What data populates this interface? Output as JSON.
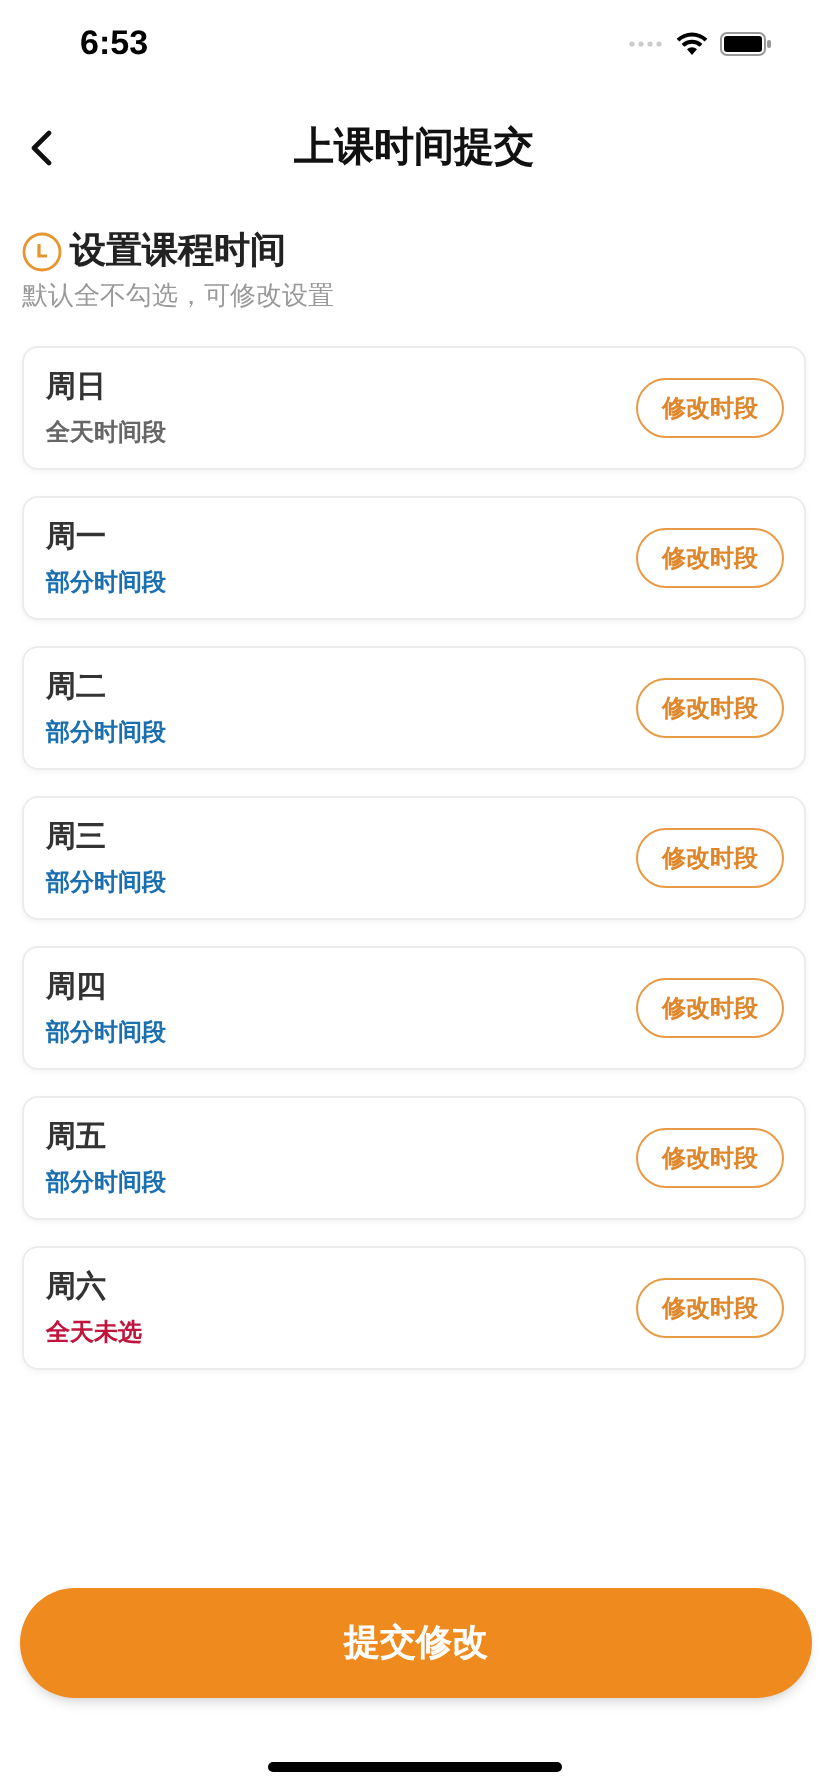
{
  "status_bar": {
    "time": "6:53"
  },
  "nav": {
    "title": "上课时间提交"
  },
  "section": {
    "title": "设置课程时间",
    "subtitle": "默认全不勾选，可修改设置"
  },
  "days": [
    {
      "name": "周日",
      "status": "全天时间段",
      "color": "#666666",
      "action": "修改时段"
    },
    {
      "name": "周一",
      "status": "部分时间段",
      "color": "#1a6fb0",
      "action": "修改时段"
    },
    {
      "name": "周二",
      "status": "部分时间段",
      "color": "#1a6fb0",
      "action": "修改时段"
    },
    {
      "name": "周三",
      "status": "部分时间段",
      "color": "#1a6fb0",
      "action": "修改时段"
    },
    {
      "name": "周四",
      "status": "部分时间段",
      "color": "#1a6fb0",
      "action": "修改时段"
    },
    {
      "name": "周五",
      "status": "部分时间段",
      "color": "#1a6fb0",
      "action": "修改时段"
    },
    {
      "name": "周六",
      "status": "全天未选",
      "color": "#c0143c",
      "action": "修改时段"
    }
  ],
  "submit": "提交修改"
}
